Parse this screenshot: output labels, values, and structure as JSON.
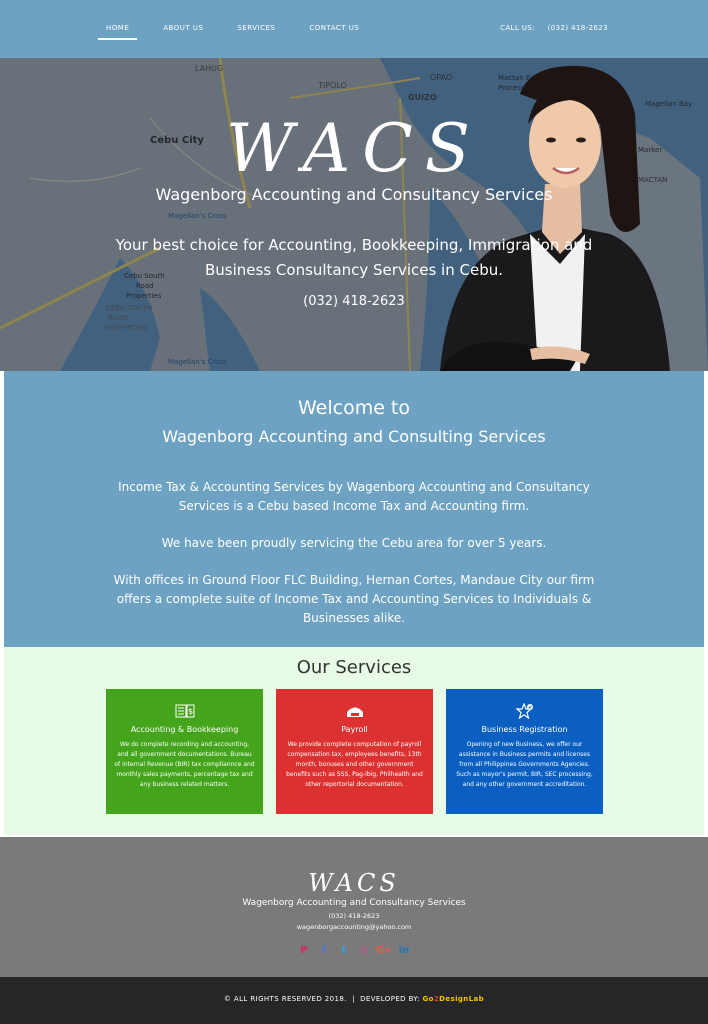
{
  "nav": {
    "items": [
      "HOME",
      "ABOUT US",
      "SERVICES",
      "CONTACT US"
    ],
    "call_label": "CALL US:",
    "call_phone": "(032) 418-2623"
  },
  "hero": {
    "logo": "WACS",
    "subtitle": "Wagenborg Accounting and Consultancy Services",
    "tagline": "Your best choice for Accounting, Bookkeeping, Immigration and Business Consultancy Services in Cebu.",
    "phone": "(032) 418-2623",
    "map_labels": [
      "LAHUG",
      "TIPOLO",
      "GUIZO",
      "OPAO",
      "Cebu City",
      "Magellan's Cross",
      "Cebu South Road Properties",
      "CEBU SOUTH ROAD PROPERTIES",
      "Mactan Export Processing Zone 1",
      "Magellan Bay",
      "Marker",
      "MACTAN",
      "Magellan's Cross"
    ]
  },
  "welcome": {
    "heading": "Welcome to",
    "subheading": "Wagenborg Accounting and Consulting Services",
    "paragraphs": [
      "Income Tax & Accounting Services by Wagenborg Accounting and Consultancy Services is a Cebu based Income Tax and Accounting firm.",
      "We have been proudly servicing the Cebu area for over 5 years.",
      "With offices in Ground Floor FLC Building, Hernan Cortes, Mandaue City our firm offers a complete suite of Income Tax and Accounting Services to Individuals & Businesses alike."
    ]
  },
  "services": {
    "heading": "Our Services",
    "cards": [
      {
        "title": "Accounting & Bookkeeping",
        "desc": "We do complete recording and accounting, and all government documentations. Bureau of internal Revenue (BIR) tax compliannce and monthly sales payments, percentage tax and any business related matters.",
        "color": "#44a41b",
        "icon": "ledger-icon"
      },
      {
        "title": "Payroll",
        "desc": "We provide complete computation of payroll compensation tax, employees benefits, 13th month, bonuses and other government benefits such as SSS, Pag-ibig, Philhealth and other reportorial documentation.",
        "color": "#dc3131",
        "icon": "payroll-icon"
      },
      {
        "title": "Business Registration",
        "desc": "Opening of new Business, we offer our assistance in Business permits and licenses from all Philippines Governments Agencies. Such as mayor's permit, BIR, SEC processing, and any other government accreditation.",
        "color": "#0a5fc1",
        "icon": "star-badge-icon"
      }
    ]
  },
  "footer": {
    "logo": "WACS",
    "name": "Wagenborg Accounting and Consultancy Services",
    "phone": "(032) 418-2623",
    "email": "wagenborgaccounting@yahoo.com",
    "social": [
      {
        "icon": "pinterest-icon",
        "glyph": "P",
        "color": "#e0245e"
      },
      {
        "icon": "facebook-icon",
        "glyph": "f",
        "color": "#4a7bd1"
      },
      {
        "icon": "twitter-icon",
        "glyph": "t",
        "color": "#2fa3e6"
      },
      {
        "icon": "instagram-icon",
        "glyph": "◎",
        "color": "#c7478f"
      },
      {
        "icon": "google-plus-icon",
        "glyph": "G+",
        "color": "#e85b46"
      },
      {
        "icon": "linkedin-icon",
        "glyph": "in",
        "color": "#1f77b8"
      }
    ]
  },
  "bottom": {
    "rights": "© ALL RIGHTS RESERVED 2018.",
    "separator": "|",
    "developed_by": "DEVELOPED BY:",
    "brand_a": "Go",
    "brand_b": "2",
    "brand_c": "DesignLab"
  }
}
